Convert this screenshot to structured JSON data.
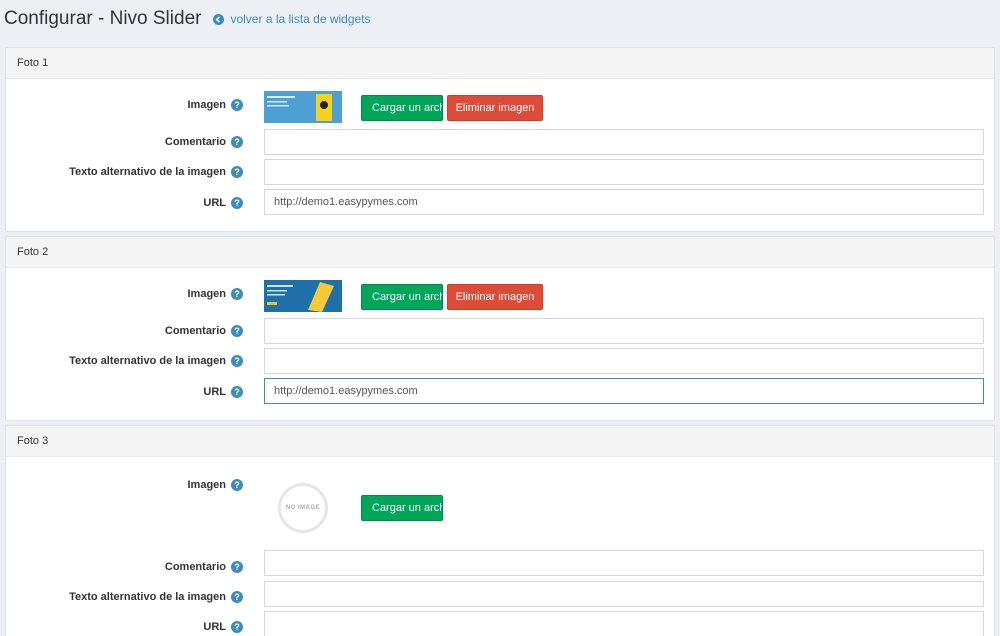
{
  "header": {
    "title": "Configurar - Nivo Slider",
    "back_link": "volver a la lista de widgets"
  },
  "labels": {
    "image": "Imagen",
    "comment": "Comentario",
    "alt_text": "Texto alternativo de la imagen",
    "url": "URL",
    "help": "?"
  },
  "buttons": {
    "upload": "Cargar un archivo",
    "delete": "Eliminar imagen"
  },
  "panels": [
    {
      "title": "Foto 1",
      "comment": "",
      "alt_text": "",
      "url": "http://demo1.easypymes.com"
    },
    {
      "title": "Foto 2",
      "comment": "",
      "alt_text": "",
      "url": "http://demo1.easypymes.com"
    },
    {
      "title": "Foto 3",
      "comment": "",
      "alt_text": "",
      "url": "",
      "no_image_text": "NO IMAGE"
    }
  ],
  "colors": {
    "accent": "#3c8dbc",
    "upload": "#00a65a",
    "delete": "#dd4b39"
  }
}
